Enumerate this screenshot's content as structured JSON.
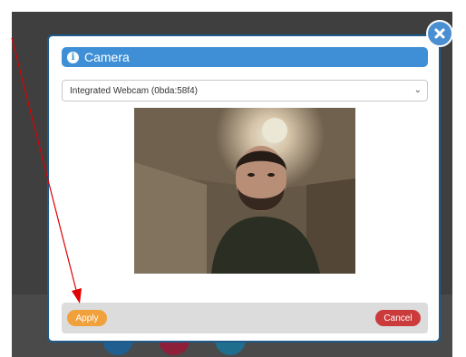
{
  "dialog": {
    "title": "Camera",
    "camera_select": {
      "selected": "Integrated Webcam (0bda:58f4)"
    },
    "apply_label": "Apply",
    "cancel_label": "Cancel"
  },
  "icons": {
    "close": "close-icon",
    "info": "info-icon",
    "chevron": "chevron-down-icon"
  },
  "colors": {
    "header_bg": "#3e8fd6",
    "apply_bg": "#f0a13b",
    "cancel_bg": "#cc3b3b",
    "close_bg": "#4a8fd1",
    "annotation_arrow": "#e00000"
  }
}
